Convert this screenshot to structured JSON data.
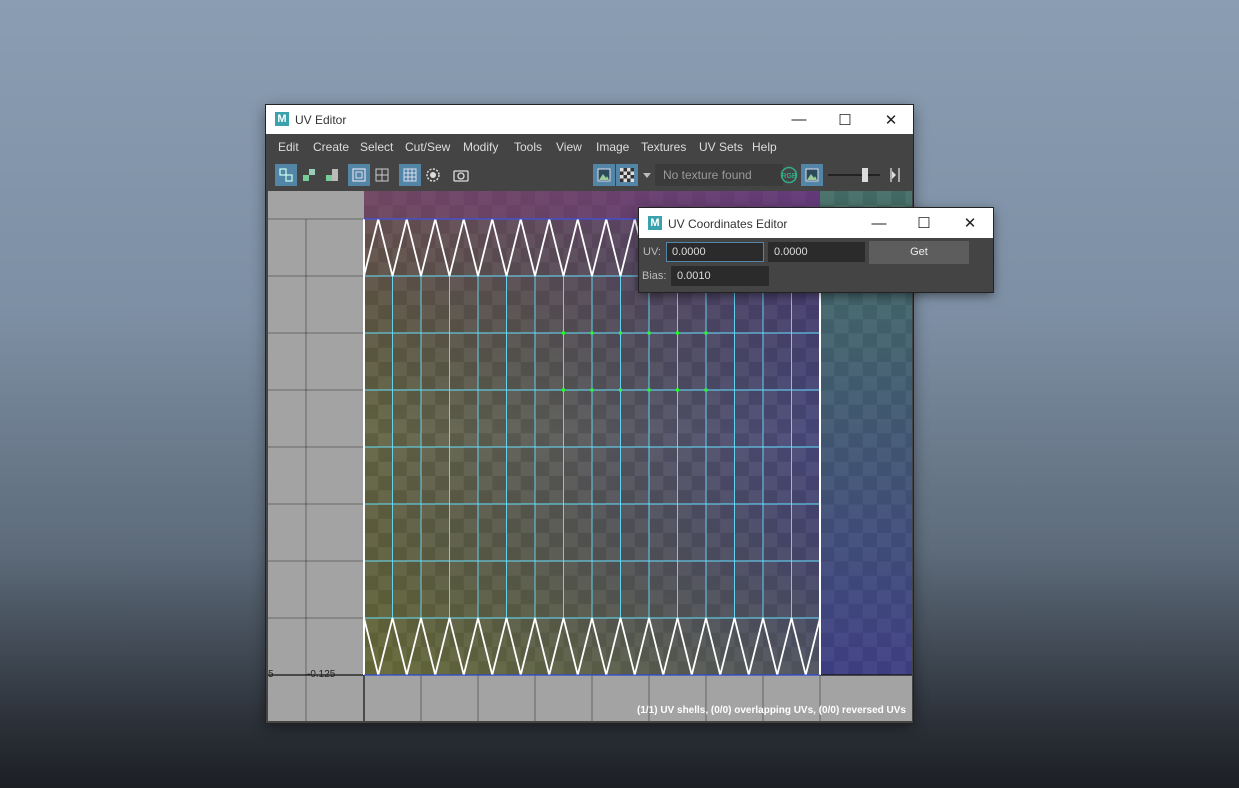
{
  "main_window": {
    "title": "UV Editor",
    "menu": [
      "Edit",
      "Create",
      "Select",
      "Cut/Sew",
      "Modify",
      "Tools",
      "View",
      "Image",
      "Textures",
      "UV Sets",
      "Help"
    ],
    "texture_dropdown": "No texture found",
    "axis_labels": {
      "left": "5",
      "right": "-0.125"
    },
    "status": "(1/1) UV shells, (0/0) overlapping UVs, (0/0) reversed UVs"
  },
  "dialog": {
    "title": "UV Coordinates Editor",
    "uv_label": "UV:",
    "u_value": "0.0000",
    "v_value": "0.0000",
    "get_label": "Get",
    "bias_label": "Bias:",
    "bias_value": "0.0010"
  },
  "icons": {
    "logo": "maya-m-icon",
    "minimize": "minimize-icon",
    "maximize": "maximize-icon",
    "close": "close-icon"
  },
  "colors": {
    "title_bg": "#ffffff",
    "panel_bg": "#444444",
    "accent": "#5285a6",
    "uv_edge": "#66e0ff",
    "uv_border": "#ffffff",
    "selected_uv": "#22ff22"
  }
}
